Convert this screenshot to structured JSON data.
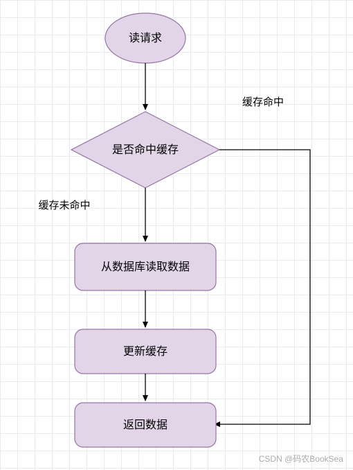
{
  "nodes": {
    "start": {
      "label": "读请求"
    },
    "decision": {
      "label": "是否命中缓存"
    },
    "readdb": {
      "label": "从数据库读取数据"
    },
    "updatecache": {
      "label": "更新缓存"
    },
    "return": {
      "label": "返回数据"
    }
  },
  "edges": {
    "hit": {
      "label": "缓存命中"
    },
    "miss": {
      "label": "缓存未命中"
    }
  },
  "colors": {
    "fill": "#e1d5e7",
    "stroke": "#9673a6"
  },
  "watermark": "CSDN @码农BookSea"
}
